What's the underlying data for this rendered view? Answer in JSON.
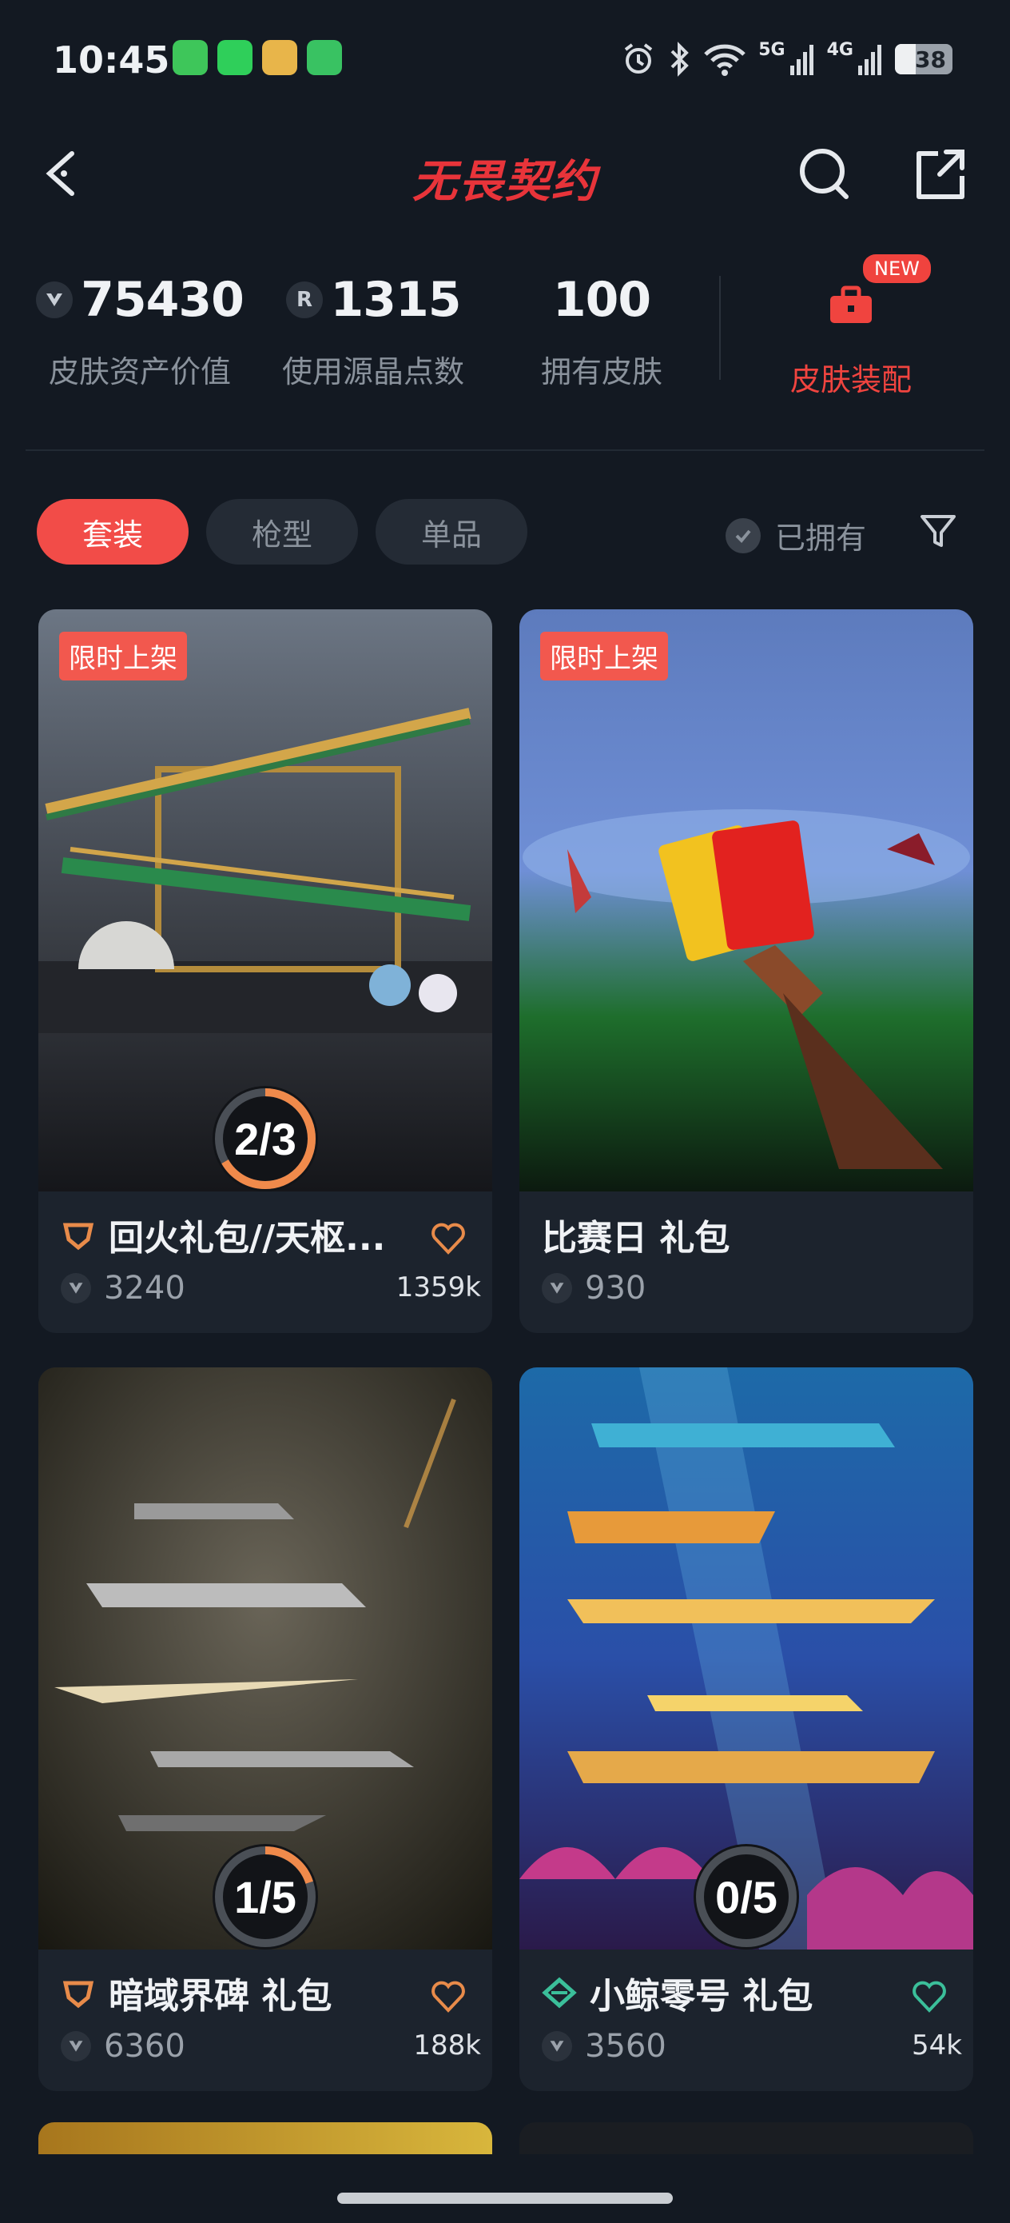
{
  "status_bar": {
    "time": "10:45",
    "net_5g": "5G",
    "net_4g": "4G",
    "battery": "38"
  },
  "header": {
    "title": "无畏契约"
  },
  "stats": [
    {
      "value": "75430",
      "label": "皮肤资产价值",
      "icon": "vp-icon"
    },
    {
      "value": "1315",
      "label": "使用源晶点数",
      "icon": "radianite-icon"
    },
    {
      "value": "100",
      "label": "拥有皮肤"
    }
  ],
  "equip": {
    "label": "皮肤装配",
    "badge": "NEW"
  },
  "filters": {
    "tabs": [
      "套装",
      "枪型",
      "单品"
    ],
    "owned_label": "已拥有"
  },
  "colors": {
    "accent": "#f24c48",
    "progress_orange": "#f08a4b",
    "progress_green": "#3bbf9a",
    "background": "#131922"
  },
  "cards": [
    {
      "tag": "限时上架",
      "progress": "2/3",
      "progress_fraction": 0.667,
      "name": "回火礼包//天枢...",
      "price": "3240",
      "likes": "1359k",
      "tier_icon": "tier-orange-icon"
    },
    {
      "tag": "限时上架",
      "name": "比赛日 礼包",
      "price": "930"
    },
    {
      "progress": "1/5",
      "progress_fraction": 0.2,
      "name": "暗域界碑 礼包",
      "price": "6360",
      "likes": "188k",
      "tier_icon": "tier-orange-icon"
    },
    {
      "progress": "0/5",
      "progress_fraction": 0,
      "name": "小鲸零号 礼包",
      "price": "3560",
      "likes": "54k",
      "tier_icon": "tier-green-icon"
    }
  ]
}
